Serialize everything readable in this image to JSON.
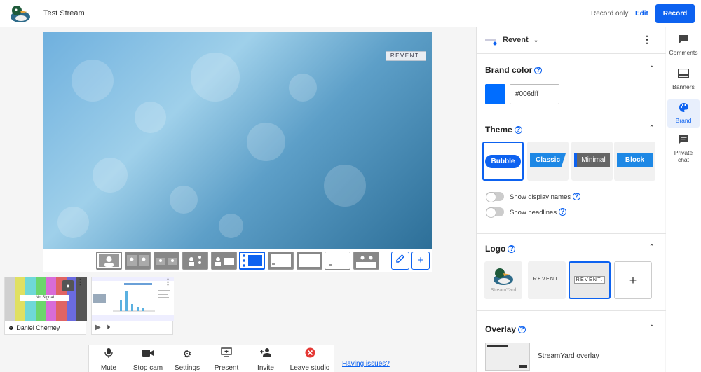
{
  "header": {
    "stream_title": "Test Stream",
    "record_only": "Record only",
    "edit_label": "Edit",
    "record_label": "Record"
  },
  "stage": {
    "logo_text": "REVENT."
  },
  "participants": [
    {
      "name": "Daniel Cherney",
      "no_signal": "No Signal"
    }
  ],
  "controls": [
    {
      "label": "Mute",
      "icon": "microphone-icon"
    },
    {
      "label": "Stop cam",
      "icon": "camera-icon"
    },
    {
      "label": "Settings",
      "icon": "gear-icon"
    },
    {
      "label": "Present",
      "icon": "present-icon"
    },
    {
      "label": "Invite",
      "icon": "add-person-icon"
    },
    {
      "label": "Leave studio",
      "icon": "close-circle-icon"
    }
  ],
  "having_issues": "Having issues?",
  "panel": {
    "brand_name": "Revent",
    "brand_color": {
      "title": "Brand color",
      "hex": "#006dff"
    },
    "theme": {
      "title": "Theme",
      "options": [
        "Bubble",
        "Classic",
        "Minimal",
        "Block"
      ],
      "selected": "Bubble",
      "show_display_names": "Show display names",
      "show_headlines": "Show headlines"
    },
    "logo": {
      "title": "Logo",
      "items": [
        "StreamYard",
        "REVENT.",
        "REVENT."
      ]
    },
    "overlay": {
      "title": "Overlay",
      "items": [
        "StreamYard overlay"
      ]
    }
  },
  "sidebar": {
    "items": [
      {
        "label": "Comments",
        "icon": "comment-icon"
      },
      {
        "label": "Banners",
        "icon": "banner-icon"
      },
      {
        "label": "Brand",
        "icon": "palette-icon",
        "active": true
      },
      {
        "label": "Private chat",
        "icon": "chat-icon"
      }
    ]
  },
  "colors": {
    "accent": "#0d62f0",
    "brand": "#006dff"
  }
}
